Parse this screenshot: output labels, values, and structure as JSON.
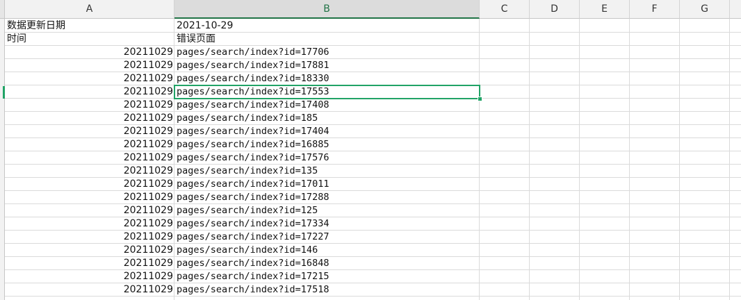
{
  "columns": [
    "A",
    "B",
    "C",
    "D",
    "E",
    "F",
    "G"
  ],
  "active_column": "B",
  "header_rows": [
    {
      "a": "数据更新日期",
      "b": "2021-10-29"
    },
    {
      "a": "时间",
      "b": "错误页面"
    }
  ],
  "rows": [
    {
      "a": "20211029",
      "b": "pages/search/index?id=17706"
    },
    {
      "a": "20211029",
      "b": "pages/search/index?id=17881"
    },
    {
      "a": "20211029",
      "b": "pages/search/index?id=18330"
    },
    {
      "a": "20211029",
      "b": "pages/search/index?id=17553"
    },
    {
      "a": "20211029",
      "b": "pages/search/index?id=17408"
    },
    {
      "a": "20211029",
      "b": "pages/search/index?id=185"
    },
    {
      "a": "20211029",
      "b": "pages/search/index?id=17404"
    },
    {
      "a": "20211029",
      "b": "pages/search/index?id=16885"
    },
    {
      "a": "20211029",
      "b": "pages/search/index?id=17576"
    },
    {
      "a": "20211029",
      "b": "pages/search/index?id=135"
    },
    {
      "a": "20211029",
      "b": "pages/search/index?id=17011"
    },
    {
      "a": "20211029",
      "b": "pages/search/index?id=17288"
    },
    {
      "a": "20211029",
      "b": "pages/search/index?id=125"
    },
    {
      "a": "20211029",
      "b": "pages/search/index?id=17334"
    },
    {
      "a": "20211029",
      "b": "pages/search/index?id=17227"
    },
    {
      "a": "20211029",
      "b": "pages/search/index?id=146"
    },
    {
      "a": "20211029",
      "b": "pages/search/index?id=16848"
    },
    {
      "a": "20211029",
      "b": "pages/search/index?id=17215"
    },
    {
      "a": "20211029",
      "b": "pages/search/index?id=17518"
    }
  ],
  "selected_cell": {
    "row_index": 3,
    "column": "B"
  },
  "colors": {
    "accent": "#21a366",
    "header_bg": "#f2f2f2",
    "grid": "#dadada"
  }
}
